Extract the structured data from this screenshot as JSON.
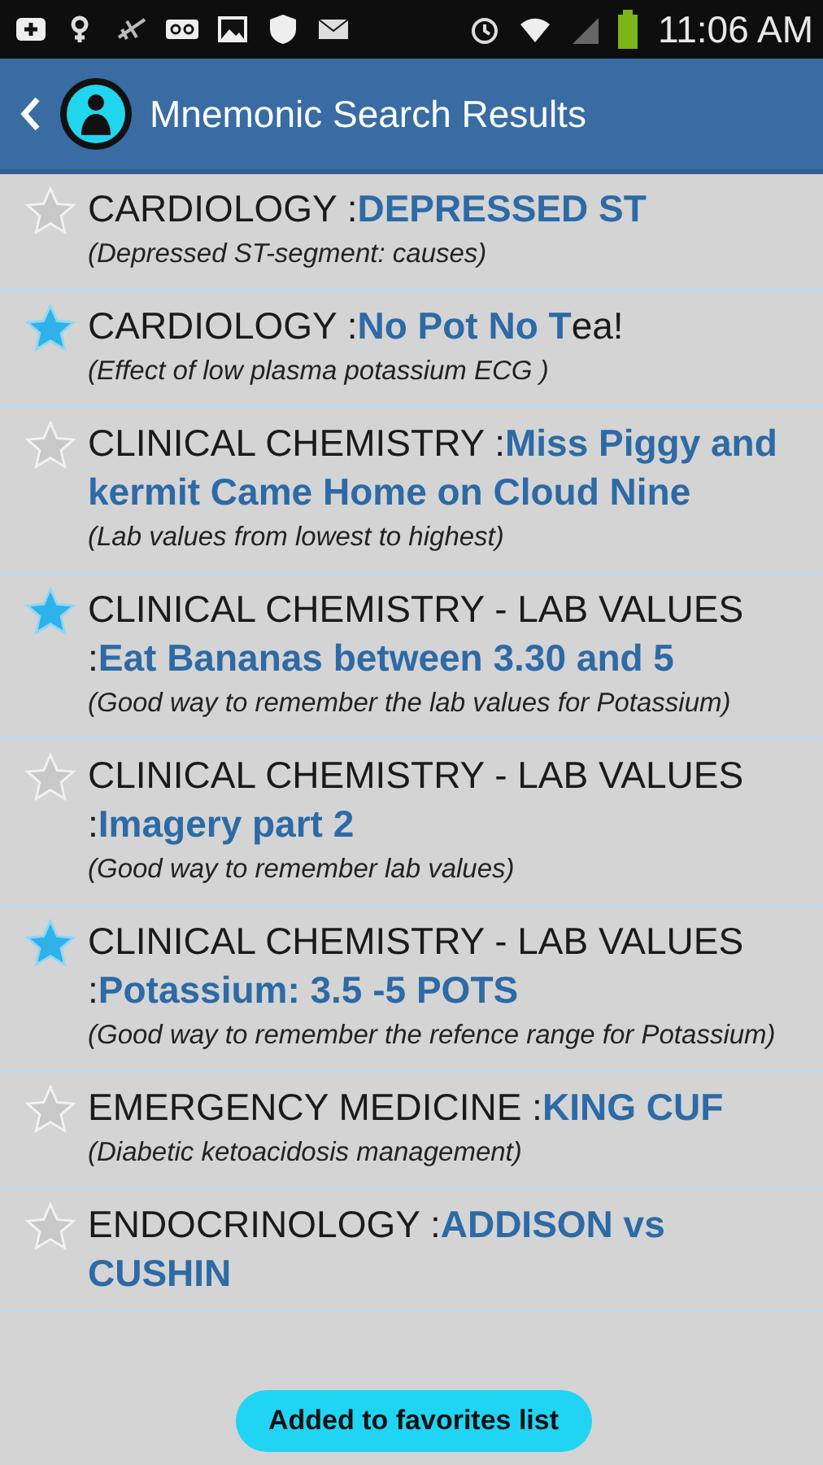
{
  "status_bar": {
    "time": "11:06 AM"
  },
  "app_bar": {
    "title": "Mnemonic Search Results"
  },
  "results": [
    {
      "heading": "CARDIOLOGY :**DEPRESSED ST**",
      "note": "(Depressed ST-segment: causes)",
      "favorite": false
    },
    {
      "heading": "CARDIOLOGY :**No Pot No T**ea!",
      "note": "(Effect of low plasma potassium ECG )",
      "favorite": true
    },
    {
      "heading": "CLINICAL CHEMISTRY :**Miss Piggy and kermit Came Home on Cloud Nine**",
      "note": "(Lab values from lowest to highest)",
      "favorite": false
    },
    {
      "heading": "CLINICAL CHEMISTRY - LAB VALUES :**Eat Bananas between 3.30 and 5**",
      "note": "(Good way to remember the lab values for Potassium)",
      "favorite": true
    },
    {
      "heading": "CLINICAL CHEMISTRY - LAB VALUES :**Imagery part 2**",
      "note": "(Good  way to remember lab values)",
      "favorite": false
    },
    {
      "heading": "CLINICAL CHEMISTRY - LAB VALUES :**Potassium: 3.5 -5 POTS**",
      "note": "(Good way to remember the refence range for Potassium)",
      "favorite": true
    },
    {
      "heading": "EMERGENCY MEDICINE :**KING CUF**",
      "note": "(Diabetic ketoacidosis management)",
      "favorite": false
    },
    {
      "heading": "ENDOCRINOLOGY :**ADDISON vs CUSHIN**",
      "favorite": false
    }
  ],
  "toast": {
    "text": "Added to favorites list"
  }
}
